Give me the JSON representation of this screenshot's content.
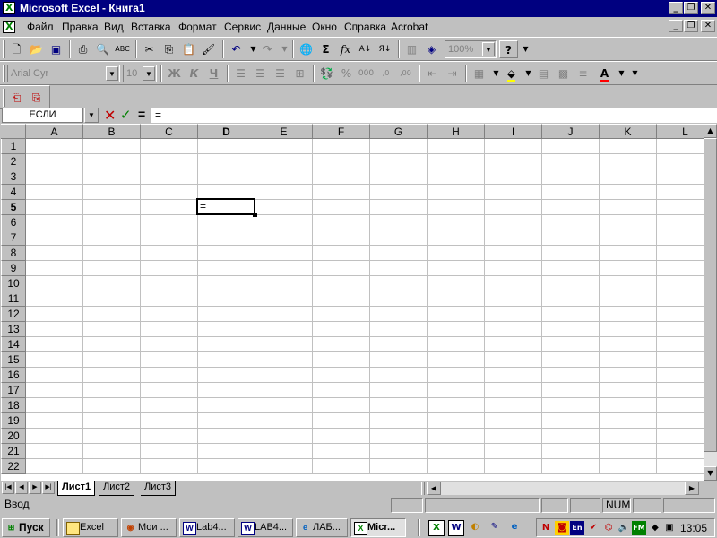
{
  "title_bar": {
    "title": "Microsoft Excel - Книга1",
    "minimize": "_",
    "restore": "❐",
    "close": "✕"
  },
  "menu": {
    "items": [
      "Файл",
      "Правка",
      "Вид",
      "Вставка",
      "Формат",
      "Сервис",
      "Данные",
      "Окно",
      "Справка",
      "Acrobat"
    ]
  },
  "standard_toolbar": {
    "zoom": "100%"
  },
  "format_toolbar": {
    "font": "Arial Cyr",
    "size": "10"
  },
  "formula_bar": {
    "name_box": "ЕСЛИ",
    "equals": "=",
    "content": "="
  },
  "columns": [
    "A",
    "B",
    "C",
    "D",
    "E",
    "F",
    "G",
    "H",
    "I",
    "J",
    "K",
    "L"
  ],
  "rows": [
    "1",
    "2",
    "3",
    "4",
    "5",
    "6",
    "7",
    "8",
    "9",
    "10",
    "11",
    "12",
    "13",
    "14",
    "15",
    "16",
    "17",
    "18",
    "19",
    "20",
    "21",
    "22"
  ],
  "active_cell": {
    "ref": "D5",
    "value": "="
  },
  "sheet_tabs": [
    "Лист1",
    "Лист2",
    "Лист3"
  ],
  "status": {
    "mode": "Ввод",
    "num": "NUM"
  },
  "taskbar": {
    "start": "Пуск",
    "tasks": [
      "Excel",
      "Мои ...",
      "Lab4...",
      "LAB4...",
      "ЛАБ...",
      "Micr..."
    ],
    "tray_icons": [
      "N",
      "En",
      "FM"
    ],
    "clock": "13:05"
  },
  "colors": {
    "titlebar": "#000080",
    "face": "#c0c0c0",
    "grid": "#c0c0c0"
  }
}
